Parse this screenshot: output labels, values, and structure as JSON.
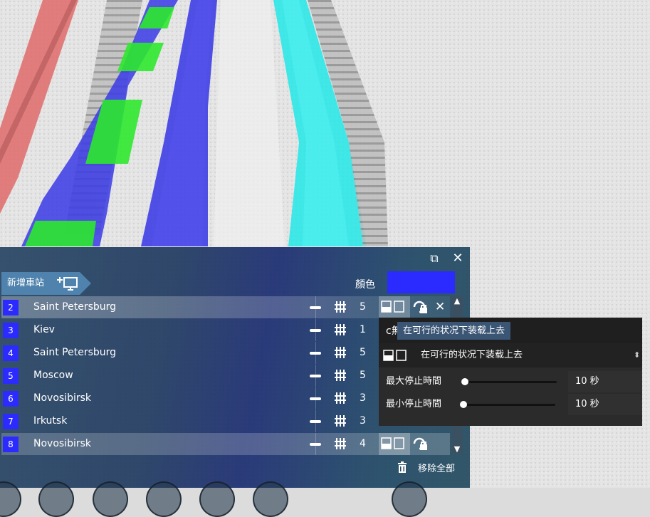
{
  "window": {
    "popout_icon": "popout-icon",
    "close_icon": "close-icon",
    "close_glyph": "✕",
    "popout_glyph": "⧉"
  },
  "header": {
    "add_stop_label": "新增車站",
    "color_label": "顏色",
    "line_color": "#2b2bff"
  },
  "stops": [
    {
      "num": "2",
      "name": "Saint Petersburg",
      "platform": "5",
      "selected": false,
      "show_load": true,
      "show_x": true
    },
    {
      "num": "3",
      "name": "Kiev",
      "platform": "1",
      "selected": false,
      "show_load": false,
      "show_x": false
    },
    {
      "num": "4",
      "name": "Saint Petersburg",
      "platform": "5",
      "selected": false,
      "show_load": false,
      "show_x": false
    },
    {
      "num": "5",
      "name": "Moscow",
      "platform": "5",
      "selected": false,
      "show_load": false,
      "show_x": false
    },
    {
      "num": "6",
      "name": "Novosibirsk",
      "platform": "3",
      "selected": false,
      "show_load": false,
      "show_x": false
    },
    {
      "num": "7",
      "name": "Irkutsk",
      "platform": "3",
      "selected": false,
      "show_load": false,
      "show_x": false
    },
    {
      "num": "8",
      "name": "Novosibirsk",
      "platform": "4",
      "selected": true,
      "show_load": true,
      "show_x": false
    }
  ],
  "footer": {
    "remove_all_label": "移除全部",
    "icon": "trash-icon"
  },
  "popup": {
    "partial_text": "c無",
    "tooltip": "在可行的状况下装载上去",
    "dropdown_label": "在可行的状况下装载上去",
    "max_stop_label": "最大停止時間",
    "max_stop_value": "10 秒",
    "max_stop_fraction": 0.0,
    "min_stop_label": "最小停止時間",
    "min_stop_value": "10 秒",
    "min_stop_fraction": 0.0
  },
  "track_colors": {
    "red": "#e06a6a",
    "green": "#2ee82e",
    "blue": "#3a3ae6",
    "cyan": "#22e8e8"
  }
}
